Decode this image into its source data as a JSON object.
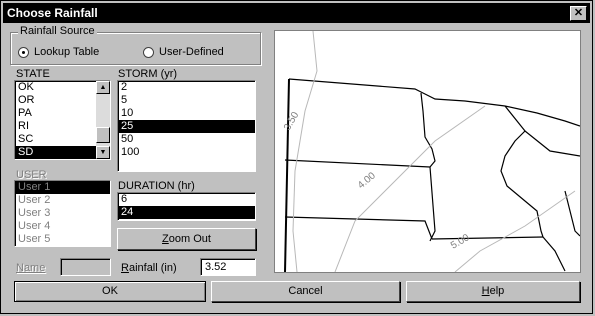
{
  "window": {
    "title": "Choose Rainfall",
    "close_label": "✕"
  },
  "rainfall_source": {
    "legend": "Rainfall Source",
    "options": [
      {
        "label": "Lookup Table",
        "selected": true
      },
      {
        "label": "User-Defined",
        "selected": false
      }
    ]
  },
  "state": {
    "label": "STATE",
    "items": [
      "OK",
      "OR",
      "PA",
      "RI",
      "SC",
      "SD"
    ],
    "selected": "SD"
  },
  "storm": {
    "label": "STORM (yr)",
    "items": [
      "2",
      "5",
      "10",
      "25",
      "50",
      "100"
    ],
    "selected": "25"
  },
  "user": {
    "label": "USER",
    "items": [
      "User 1",
      "User 2",
      "User 3",
      "User 4",
      "User 5"
    ],
    "selected": "User 1"
  },
  "duration": {
    "label": "DURATION (hr)",
    "items": [
      "6",
      "24"
    ],
    "selected": "24"
  },
  "zoom_out": {
    "label_pre": "",
    "label_u": "Z",
    "label_post": "oom Out"
  },
  "name_field": {
    "label": "Name",
    "value": ""
  },
  "rainfall_field": {
    "label_u": "R",
    "label_post": "ainfall (in)",
    "value": "3.52"
  },
  "map": {
    "contour_labels": [
      "3.50",
      "4.00",
      "5.00"
    ]
  },
  "buttons": {
    "ok": "OK",
    "cancel": "Cancel",
    "help_u": "H",
    "help_post": "elp"
  },
  "colors": {
    "selection": "#000000",
    "face": "#c0c0c0"
  }
}
